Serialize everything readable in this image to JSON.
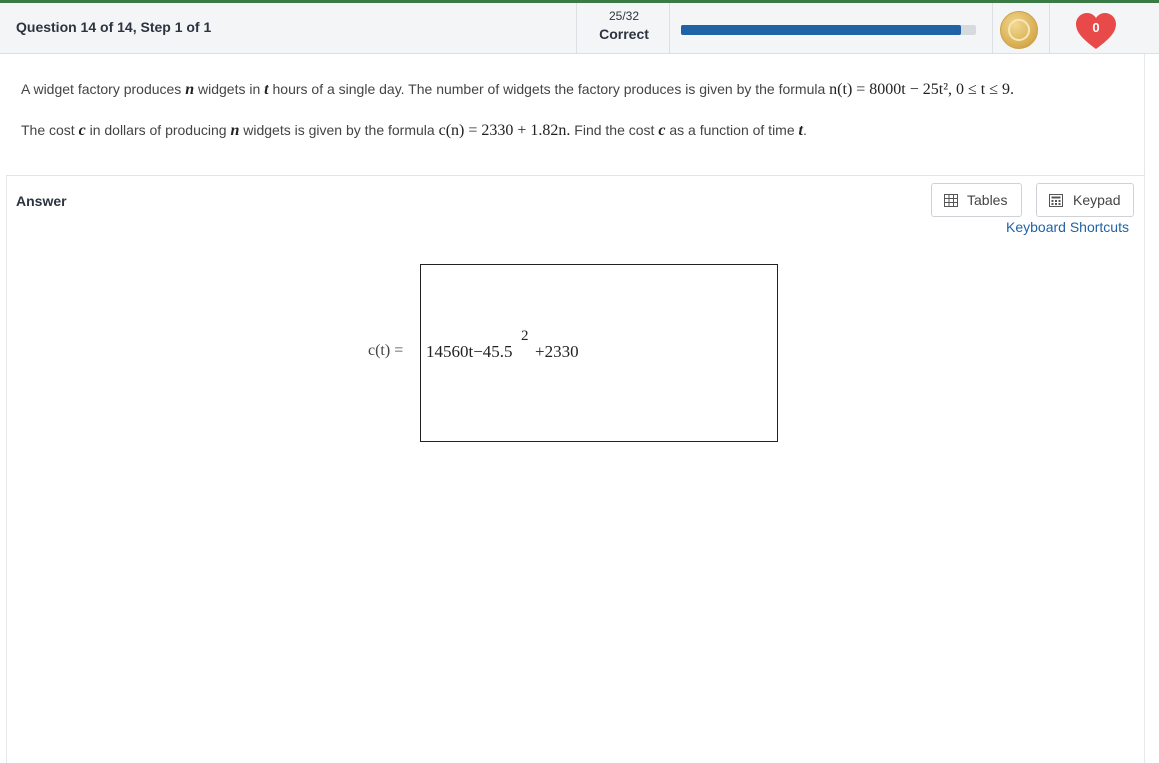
{
  "header": {
    "question_label": "Question 14 of 14, Step 1 of 1",
    "score": "25/32",
    "status": "Correct",
    "progress_percent": 95,
    "coin_icon": "coin-icon",
    "hearts_count": "0",
    "colors": {
      "accent": "#3a7a45",
      "progress": "#1f63a6",
      "heart": "#e84a4a"
    }
  },
  "question": {
    "line1_a": "A widget factory produces ",
    "line1_var_n": "n",
    "line1_b": " widgets in ",
    "line1_var_t": "t",
    "line1_c": " hours of a single day. The number of widgets the factory produces is given by the formula ",
    "formula1": "n(t) = 8000t − 25t², 0 ≤ t ≤ 9.",
    "line2_a": "The cost ",
    "line2_var_c": "c",
    "line2_b": " in dollars of producing ",
    "line2_var_n": "n",
    "line2_c": " widgets is given by the formula ",
    "formula2": "c(n) = 2330 + 1.82n.",
    "line2_d": " Find the cost ",
    "line2_var_c2": "c",
    "line2_e": " as a function of time ",
    "line2_var_t": "t",
    "line2_f": "."
  },
  "answer": {
    "label": "Answer",
    "tables_label": "Tables",
    "keypad_label": "Keypad",
    "shortcuts_label": "Keyboard Shortcuts",
    "lhs": "c(t) =",
    "expr_main": "14560t−45.5",
    "expr_exp": "2",
    "expr_rest": "+2330"
  }
}
